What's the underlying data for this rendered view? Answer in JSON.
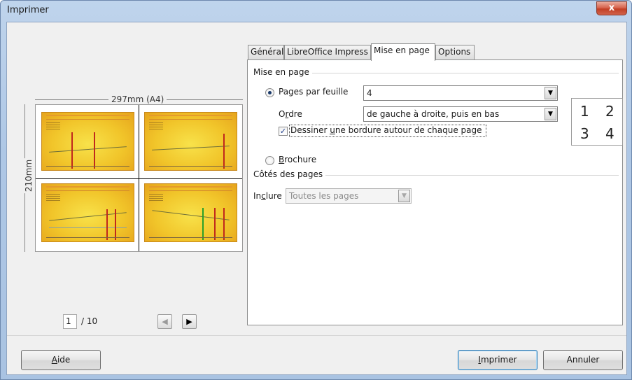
{
  "window": {
    "title": "Imprimer",
    "close_glyph": "x"
  },
  "preview": {
    "width_label": "297mm (A4)",
    "height_label": "210mm",
    "current_page": "1",
    "total_pages": "/ 10",
    "prev_glyph": "◀",
    "next_glyph": "▶"
  },
  "tabs": [
    {
      "label": "Général"
    },
    {
      "label": "LibreOffice Impress"
    },
    {
      "label": "Mise en page"
    },
    {
      "label": "Options"
    }
  ],
  "active_tab": "Mise en page",
  "mise_en_page": {
    "section_title": "Mise en page",
    "pages_par_feuille_label": "Pages par feuille",
    "pages_par_feuille_value": "4",
    "pages_par_feuille_selected": true,
    "ordre_label_pre": "O",
    "ordre_label_u": "r",
    "ordre_label_post": "dre",
    "ordre_value": "de gauche à droite, puis en bas",
    "bordure_label_pre": "Dessiner ",
    "bordure_label_u": "u",
    "bordure_label_post": "ne bordure autour de chaque page",
    "bordure_checked": true,
    "brochure_label_u": "B",
    "brochure_label_post": "rochure",
    "brochure_selected": false,
    "order_preview": [
      "1",
      "2",
      "3",
      "4"
    ]
  },
  "cotes_des_pages": {
    "section_title": "Côtés des pages",
    "inclure_label_pre": "In",
    "inclure_label_u": "c",
    "inclure_label_post": "lure",
    "inclure_value": "Toutes les pages"
  },
  "buttons": {
    "aide_u": "A",
    "aide_post": "ide",
    "imprimer_u": "I",
    "imprimer_post": "mprimer",
    "annuler": "Annuler"
  },
  "colors": {
    "title_gradient": "#bfd4ec",
    "close_button": "#c23f25",
    "slide_background": "#f1c52a"
  }
}
